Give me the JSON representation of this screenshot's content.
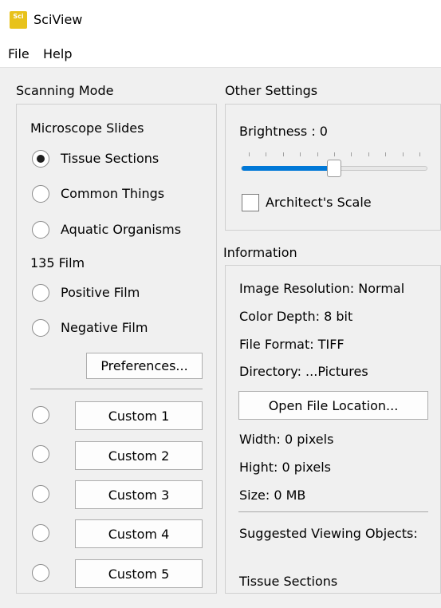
{
  "app": {
    "title": "SciView",
    "icon": "sciview-logo-icon",
    "icon_text": "Sci"
  },
  "menu": {
    "file": "File",
    "help": "Help"
  },
  "scanning_mode": {
    "title": "Scanning Mode",
    "microscope_heading": "Microscope Slides",
    "options": [
      {
        "label": "Tissue Sections",
        "checked": true
      },
      {
        "label": "Common Things",
        "checked": false
      },
      {
        "label": "Aquatic Organisms",
        "checked": false
      }
    ],
    "film_heading": "135 Film",
    "film_options": [
      {
        "label": "Positive Film",
        "checked": false
      },
      {
        "label": "Negative Film",
        "checked": false
      }
    ],
    "preferences_label": "Preferences...",
    "custom_buttons": [
      "Custom 1",
      "Custom 2",
      "Custom 3",
      "Custom 4",
      "Custom 5"
    ]
  },
  "other_settings": {
    "title": "Other Settings",
    "brightness_label": "Brightness : 0",
    "brightness_value": 0,
    "brightness_level": 0.5,
    "architects_scale_label": "Architect's Scale",
    "architects_scale_checked": false
  },
  "information": {
    "title": "Information",
    "image_resolution": "Image Resolution: Normal",
    "color_depth": "Color Depth: 8 bit",
    "file_format": "File Format: TIFF",
    "directory": "Directory: ...Pictures",
    "open_location_label": "Open File Location...",
    "width": "Width: 0 pixels",
    "height": "Hight: 0 pixels",
    "size": "Size: 0 MB",
    "suggested_title": "Suggested Viewing Objects:",
    "suggested_value": "Tissue Sections"
  },
  "colors": {
    "accent": "#0078d7",
    "icon_bg": "#e8c21a"
  }
}
